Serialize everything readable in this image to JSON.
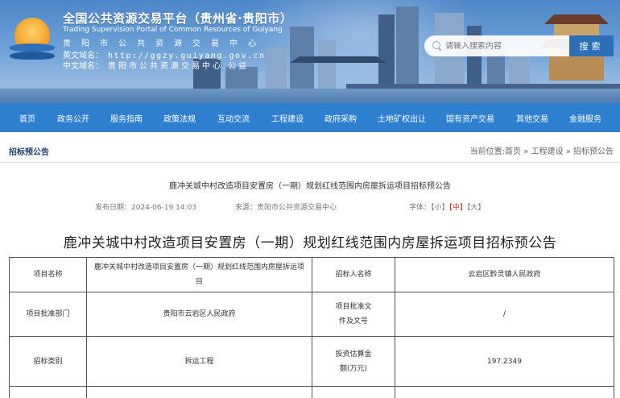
{
  "header": {
    "title": "全国公共资源交易平台（贵州省·贵阳市）",
    "subtitle_en": "Trading Supervision Portal of Common Resources of Guiyang",
    "org": "贵阳市公共资源交易中心",
    "domain_en_label": "英文域名：",
    "domain_en_value": "http://ggzy.guiyang.gov.cn",
    "domain_cn_label": "中文域名：",
    "domain_cn_value": "贵阳市公共资源交易中心.公益"
  },
  "search": {
    "placeholder": "请输入搜索内容",
    "button_label": "搜索"
  },
  "nav": {
    "items": [
      "首页",
      "政务公开",
      "服务指南",
      "政策法规",
      "互动交流",
      "工程建设",
      "政府采购",
      "土地矿权出让",
      "国有资产交易",
      "其他交易",
      "金融服务"
    ]
  },
  "breadcrumb": {
    "section": "招标预公告",
    "path": "当前位置:首页 » 工程建设 » 招标预公告"
  },
  "article": {
    "title": "鹿冲关城中村改造项目安置房（一期）规划红线范围内房屋拆运项目招标预公告",
    "publish_date": "发布日期：2024-06-19 14:03",
    "source": "来源：贵阳市公共资源交易中心",
    "font_label": "字体：",
    "font_small": "【小】",
    "font_medium": "【中】",
    "font_large": "【大】",
    "heading": "鹿冲关城中村改造项目安置房（一期）规划红线范围内房屋拆运项目招标预公告"
  },
  "table": {
    "rows": [
      {
        "label1": "项目名称",
        "value1": "鹿冲关城中村改造项目安置房（一期）规划红线范围内房屋拆运项目",
        "label2": "招标人名称",
        "value2": "云岩区黔灵镇人民政府"
      },
      {
        "label1": "项目批准部门",
        "value1": "贵阳市云岩区人民政府",
        "label2": "项目批准文件及文号",
        "value2": "/"
      },
      {
        "label1": "招标类别",
        "value1": "拆运工程",
        "label2": "投资估算金额(万元)",
        "value2": "197.2349"
      }
    ]
  },
  "colors": {
    "nav_bg": "#2f7fd0",
    "search_button": "#2b6fb8",
    "highlight_red": "#d12b1f"
  }
}
